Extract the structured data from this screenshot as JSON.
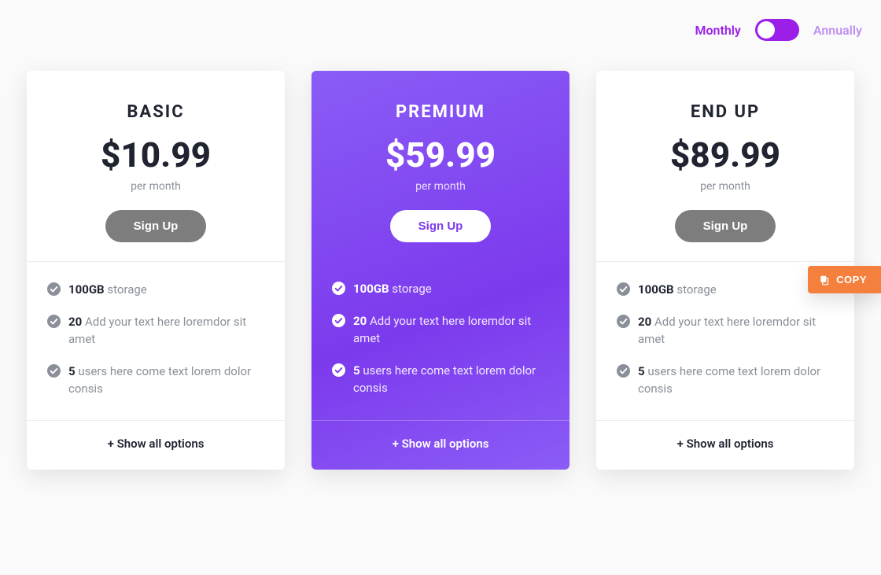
{
  "toggle": {
    "monthly_label": "Monthly",
    "annually_label": "Annually"
  },
  "copy_button": {
    "label": "COPY"
  },
  "show_all_label": "+ Show all options",
  "plans": [
    {
      "name": "BASIC",
      "price": "$10.99",
      "period": "per month",
      "signup_label": "Sign Up",
      "featured": false,
      "features": [
        {
          "bold": "100GB",
          "text": "storage"
        },
        {
          "bold": "20",
          "text": "Add your text here loremdor sit amet"
        },
        {
          "bold": "5",
          "text": "users here come text lorem dolor consis"
        }
      ]
    },
    {
      "name": "PREMIUM",
      "price": "$59.99",
      "period": "per month",
      "signup_label": "Sign Up",
      "featured": true,
      "features": [
        {
          "bold": "100GB",
          "text": "storage"
        },
        {
          "bold": "20",
          "text": "Add your text here loremdor sit amet"
        },
        {
          "bold": "5",
          "text": "users here come text lorem dolor consis"
        }
      ]
    },
    {
      "name": "END UP",
      "price": "$89.99",
      "period": "per month",
      "signup_label": "Sign Up",
      "featured": false,
      "features": [
        {
          "bold": "100GB",
          "text": "storage"
        },
        {
          "bold": "20",
          "text": "Add your text here loremdor sit amet"
        },
        {
          "bold": "5",
          "text": "users here come text lorem dolor consis"
        }
      ]
    }
  ]
}
